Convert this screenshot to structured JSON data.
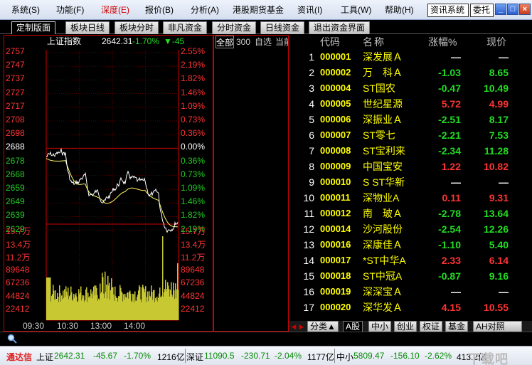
{
  "menu": {
    "items": [
      "系统(S)",
      "功能(F)",
      "深度(E)",
      "报价(B)",
      "分析(A)",
      "港股期货基金",
      "资讯(I)",
      "工具(W)",
      "帮助(H)"
    ],
    "info_button": "资讯系统",
    "trade_button": "委托",
    "minimize": "_",
    "restore": "□",
    "close": "×"
  },
  "tabs": [
    "定制版面",
    "板块日线",
    "板块分时",
    "非凡资金",
    "分时资金",
    "日线资金",
    "退出资金界面"
  ],
  "chart": {
    "index_name": "上证指数",
    "index_value": "2642.31",
    "index_pct": "-1.70%",
    "index_change": "▼-45",
    "price_labels": [
      "2757",
      "2747",
      "2737",
      "2727",
      "2717",
      "2708",
      "2698",
      "2688",
      "2678",
      "2668",
      "2659",
      "2649",
      "2639",
      "2629"
    ],
    "pct_labels": [
      "2.55%",
      "2.19%",
      "1.82%",
      "1.46%",
      "1.09%",
      "0.73%",
      "0.36%",
      "0.00%",
      "0.36%",
      "0.73%",
      "1.09%",
      "1.46%",
      "1.82%",
      "2.19%"
    ],
    "volume_labels": [
      "15.7万",
      "13.4万",
      "11.2万",
      "89648",
      "67236",
      "44824",
      "22412"
    ],
    "time_labels": [
      "09:30",
      "10:30",
      "13:00",
      "14:00"
    ],
    "colors": {
      "up": "#ff3333",
      "down": "#22cc22",
      "flat": "#ffffff",
      "price_line": "#ffffff",
      "avg_line": "#ffff66",
      "volume": "#c8c832"
    }
  },
  "sidebar": {
    "tabs": [
      "全部",
      "300",
      "自选",
      "当前"
    ]
  },
  "table": {
    "headers": {
      "code": "代码",
      "name": "称",
      "change": "涨幅%",
      "price": "现价",
      "name_prefix": "名"
    },
    "rows": [
      {
        "idx": "1",
        "code": "000001",
        "name": "深发展Ａ",
        "change": "—",
        "price": "—",
        "dir": "flat"
      },
      {
        "idx": "2",
        "code": "000002",
        "name": "万　科Ａ",
        "change": "-1.03",
        "price": "8.65",
        "dir": "down"
      },
      {
        "idx": "3",
        "code": "000004",
        "name": "ST国农",
        "change": "-0.47",
        "price": "10.49",
        "dir": "down"
      },
      {
        "idx": "4",
        "code": "000005",
        "name": "世纪星源",
        "change": "5.72",
        "price": "4.99",
        "dir": "up"
      },
      {
        "idx": "5",
        "code": "000006",
        "name": "深振业Ａ",
        "change": "-2.51",
        "price": "8.17",
        "dir": "down"
      },
      {
        "idx": "6",
        "code": "000007",
        "name": "ST零七",
        "change": "-2.21",
        "price": "7.53",
        "dir": "down"
      },
      {
        "idx": "7",
        "code": "000008",
        "name": "ST宝利来",
        "change": "-2.34",
        "price": "11.28",
        "dir": "down"
      },
      {
        "idx": "8",
        "code": "000009",
        "name": "中国宝安",
        "change": "1.22",
        "price": "10.82",
        "dir": "up"
      },
      {
        "idx": "9",
        "code": "000010",
        "name": "S ST华新",
        "change": "—",
        "price": "—",
        "dir": "flat"
      },
      {
        "idx": "10",
        "code": "000011",
        "name": "深物业A",
        "change": "0.11",
        "price": "9.31",
        "dir": "up"
      },
      {
        "idx": "11",
        "code": "000012",
        "name": "南　玻Ａ",
        "change": "-2.78",
        "price": "13.64",
        "dir": "down"
      },
      {
        "idx": "12",
        "code": "000014",
        "name": "沙河股份",
        "change": "-2.54",
        "price": "12.26",
        "dir": "down"
      },
      {
        "idx": "13",
        "code": "000016",
        "name": "深康佳Ａ",
        "change": "-1.10",
        "price": "5.40",
        "dir": "down"
      },
      {
        "idx": "14",
        "code": "000017",
        "name": "*ST中华A",
        "change": "2.33",
        "price": "6.14",
        "dir": "up"
      },
      {
        "idx": "15",
        "code": "000018",
        "name": "ST中冠A",
        "change": "-0.87",
        "price": "9.16",
        "dir": "down"
      },
      {
        "idx": "16",
        "code": "000019",
        "name": "深深宝Ａ",
        "change": "—",
        "price": "—",
        "dir": "flat"
      },
      {
        "idx": "17",
        "code": "000020",
        "name": "深华发Ａ",
        "change": "4.15",
        "price": "10.55",
        "dir": "up"
      }
    ],
    "bottom_tabs": [
      "分类▲",
      "A股",
      "中小",
      "创业",
      "权证",
      "基金",
      "AH对照"
    ]
  },
  "status": {
    "brand": "通达信",
    "sh_label": "上证",
    "sh_value": "2642.31",
    "sh_change": "-45.67",
    "sh_pct": "-1.70%",
    "sh_amount": "1216亿",
    "sz_label": "深证",
    "sz_value": "11090.5",
    "sz_change": "-230.71",
    "sz_pct": "-2.04%",
    "sz_amount": "1177亿",
    "zx_label": "中小",
    "zx_value": "5809.47",
    "zx_change": "-156.10",
    "zx_pct": "-2.62%",
    "zx_amount": "413.2亿",
    "watermark": "下载吧"
  }
}
